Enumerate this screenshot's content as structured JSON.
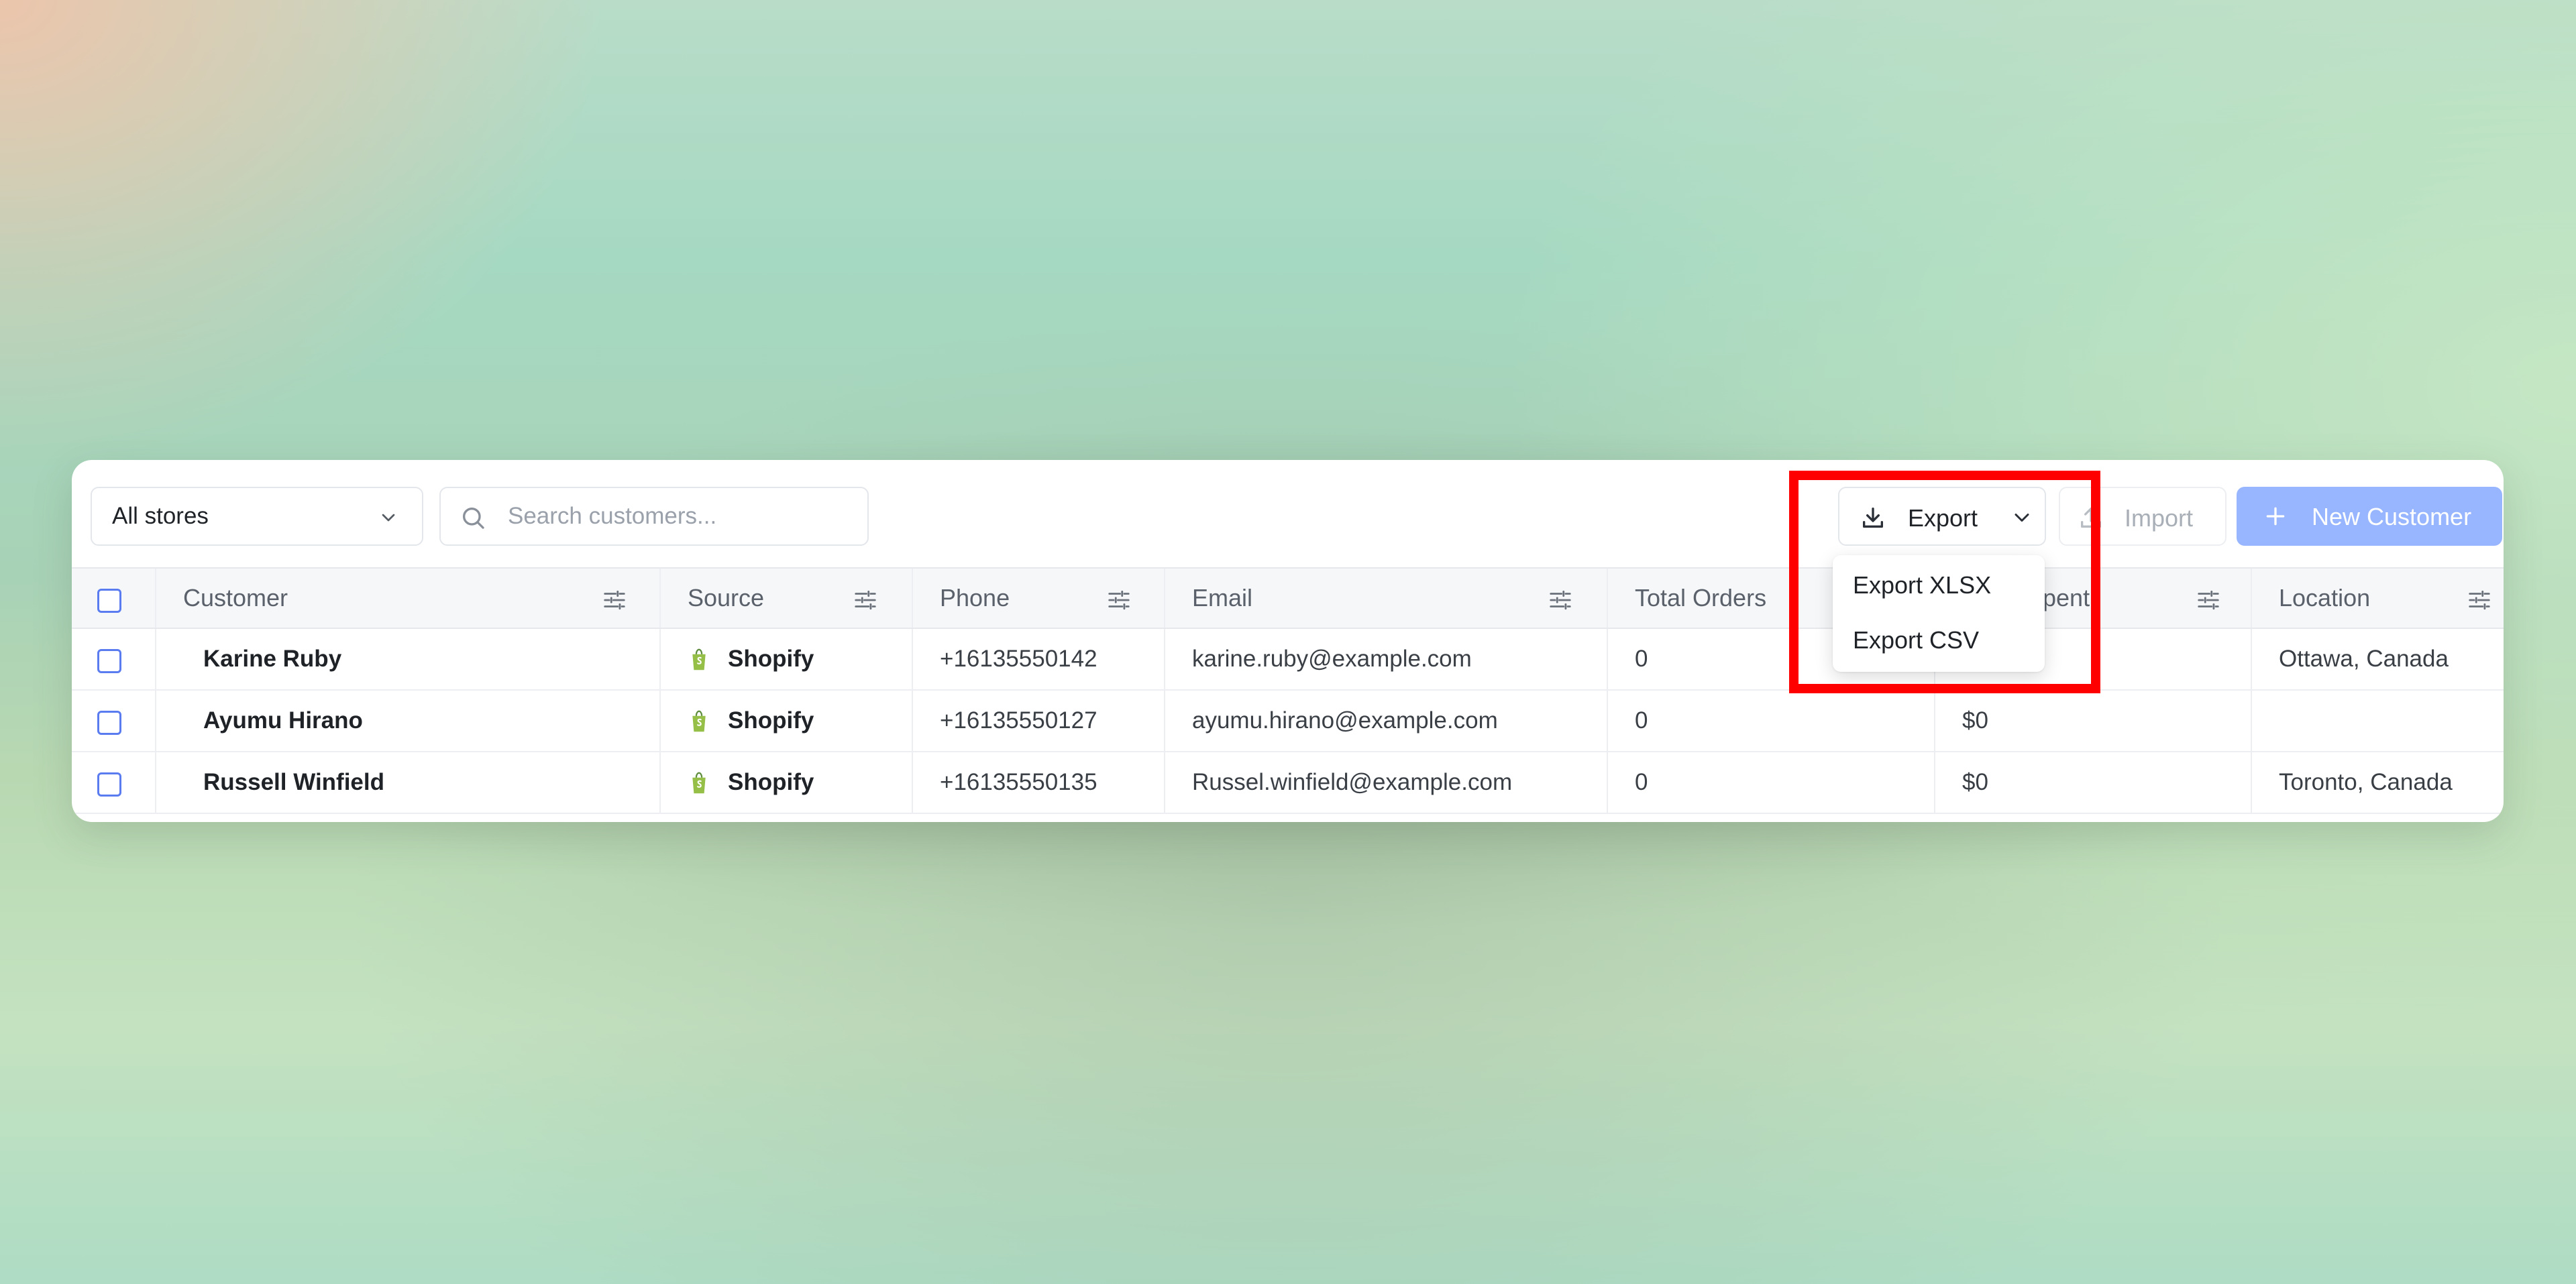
{
  "toolbar": {
    "store_select": "All stores",
    "search_placeholder": "Search customers...",
    "export_label": "Export",
    "import_label": "Import",
    "new_customer_label": "New Customer"
  },
  "table": {
    "headers": [
      "Customer",
      "Source",
      "Phone",
      "Email",
      "Total Orders",
      "Total Spent",
      "Location"
    ],
    "header_spent_visible": "pent",
    "rows": [
      {
        "customer": "Karine Ruby",
        "source": "Shopify",
        "phone": "+16135550142",
        "email": "karine.ruby@example.com",
        "orders": "0",
        "spent": "",
        "location": "Ottawa, Canada"
      },
      {
        "customer": "Ayumu Hirano",
        "source": "Shopify",
        "phone": "+16135550127",
        "email": "ayumu.hirano@example.com",
        "orders": "0",
        "spent": "$0",
        "location": ""
      },
      {
        "customer": "Russell Winfield",
        "source": "Shopify",
        "phone": "+16135550135",
        "email": "Russel.winfield@example.com",
        "orders": "0",
        "spent": "$0",
        "location": "Toronto, Canada"
      }
    ]
  },
  "export_menu": {
    "items": [
      "Export XLSX",
      "Export CSV"
    ]
  },
  "colors": {
    "primary_button": "#98b5ff",
    "checkbox_border": "#5a7cf0",
    "highlight": "#ff0000"
  }
}
